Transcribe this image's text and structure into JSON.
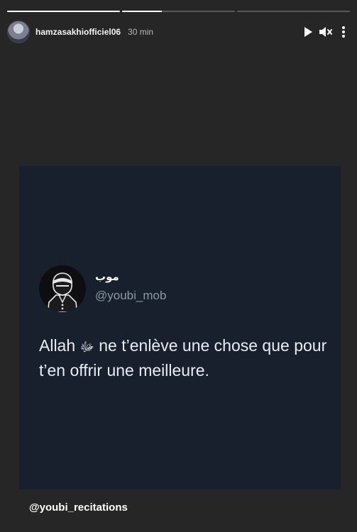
{
  "story": {
    "progress_segments": [
      {
        "fill": 1.0
      },
      {
        "fill": 0.35
      },
      {
        "fill": 0.0
      }
    ],
    "username": "hamzasakhiofficiel06",
    "time": "30 min",
    "controls": {
      "play_icon": "play-icon",
      "mute_icon": "speaker-muted-icon",
      "more_icon": "more-dots-icon"
    }
  },
  "tweet": {
    "display_name": "موب",
    "handle": "@youbi_mob",
    "text_part1": "Allah ",
    "honorific": "ﷻ",
    "text_part2": " ne t’enlève une chose que pour t’en offrir une meilleure."
  },
  "mention": "@youbi_recitations",
  "colors": {
    "background": "#262626",
    "card": "#17202c",
    "handle": "#8b98a5"
  }
}
